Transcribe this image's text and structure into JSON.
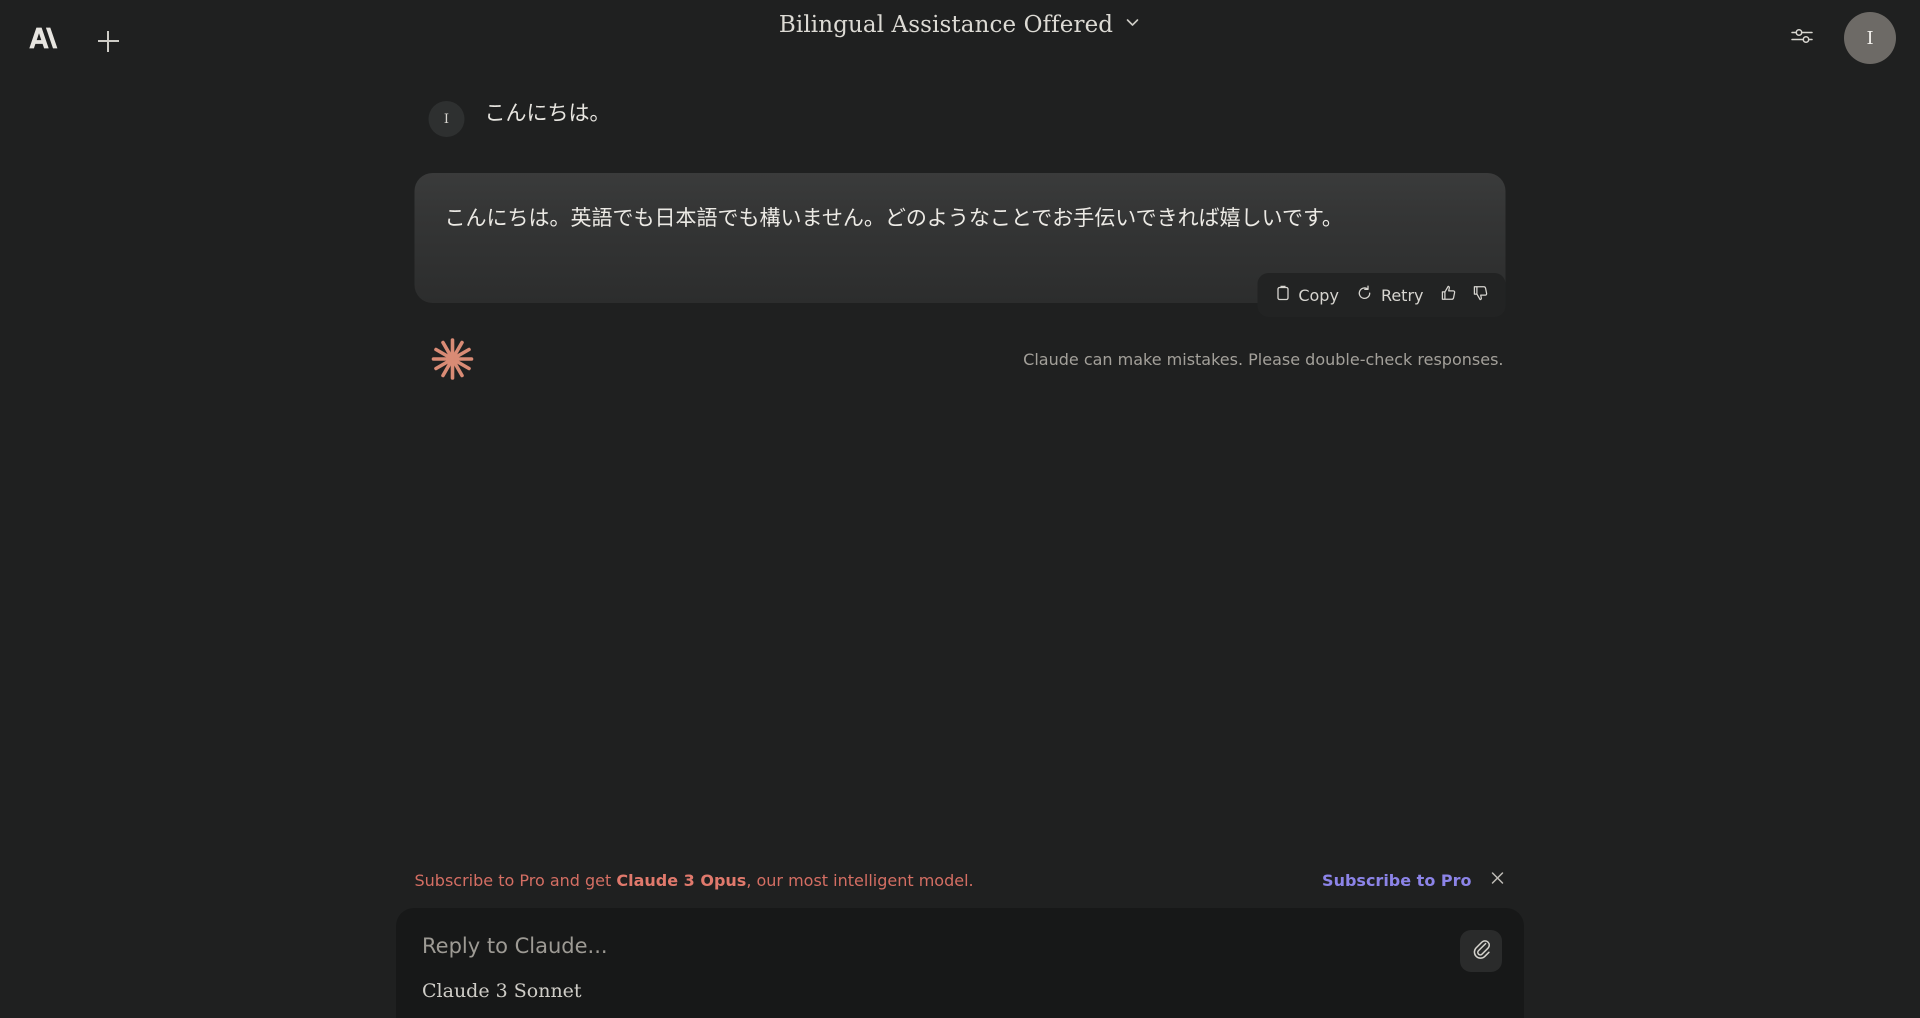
{
  "header": {
    "logo_icon": "anthropic-logo-icon",
    "new_chat_icon": "plus-icon",
    "title": "Bilingual Assistance Offered",
    "title_chevron_icon": "chevron-down-icon",
    "settings_icon": "sliders-icon",
    "avatar_initial": "I"
  },
  "conversation": {
    "user_message": {
      "avatar_initial": "I",
      "text": "こんにちは。"
    },
    "assistant_message": {
      "text": "こんにちは。英語でも日本語でも構いません。どのようなことでお手伝いできれば嬉しいです。",
      "actions": {
        "copy_label": "Copy",
        "copy_icon": "clipboard-icon",
        "retry_label": "Retry",
        "retry_icon": "refresh-icon",
        "thumbs_up_icon": "thumbs-up-icon",
        "thumbs_down_icon": "thumbs-down-icon"
      }
    },
    "brand_icon": "claude-starburst-icon",
    "disclaimer": "Claude can make mistakes. Please double-check responses."
  },
  "promo": {
    "text_before": "Subscribe to Pro and get ",
    "highlight": "Claude 3 Opus",
    "text_after": ", our most intelligent model.",
    "cta_label": "Subscribe to Pro",
    "close_icon": "close-icon"
  },
  "composer": {
    "placeholder": "Reply to Claude...",
    "value": "",
    "model_label": "Claude 3 Sonnet",
    "attach_icon": "paperclip-icon"
  },
  "colors": {
    "page_bg": "#1f2020",
    "bubble_top": "#3a3b3b",
    "accent_coral": "#d46e63",
    "accent_purple": "#8c84e8",
    "brand_star": "#d98b75"
  }
}
